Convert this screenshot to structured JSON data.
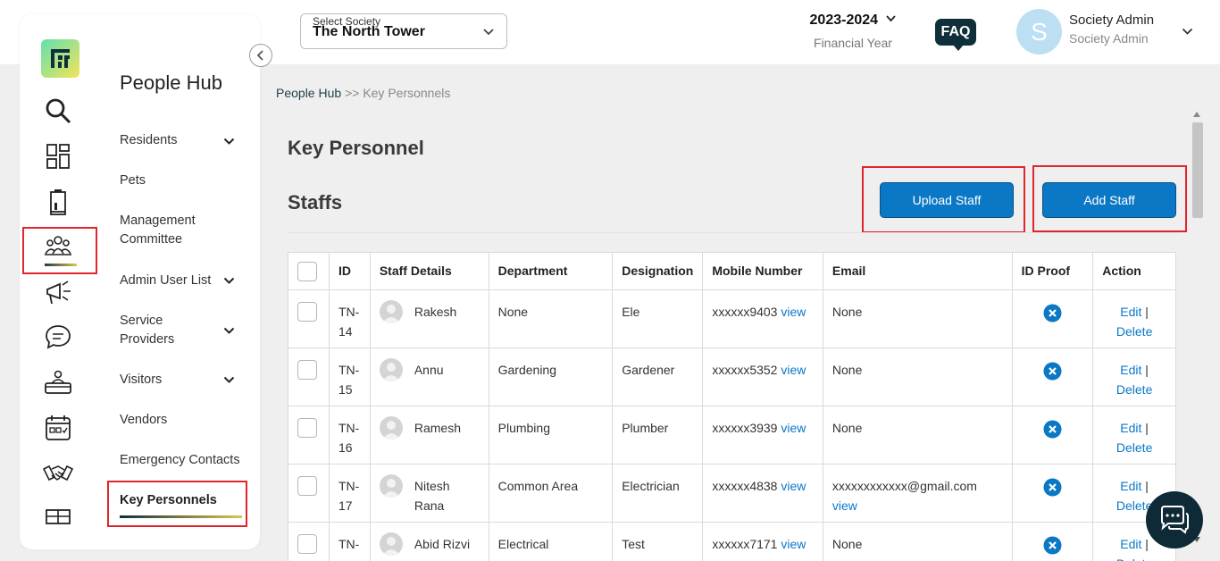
{
  "header": {
    "society_label": "Select Society",
    "society_value": "The North Tower",
    "financial_year": "2023-2024",
    "financial_year_label": "Financial Year",
    "faq_label": "FAQ",
    "avatar_initial": "S",
    "user_name": "Society Admin",
    "user_role": "Society Admin"
  },
  "sidebar": {
    "rail_icons": [
      "search-icon",
      "dashboard-icon",
      "building-icon",
      "people-icon",
      "announcement-icon",
      "chat-icon",
      "desk-service-icon",
      "calendar-icon",
      "handshake-icon",
      "package-icon"
    ],
    "hub_title": "People Hub",
    "items": [
      {
        "label": "Residents",
        "expandable": true
      },
      {
        "label": "Pets",
        "expandable": false
      },
      {
        "label": "Management Committee",
        "expandable": false
      },
      {
        "label": "Admin User List",
        "expandable": true
      },
      {
        "label": "Service Providers",
        "expandable": true
      },
      {
        "label": "Visitors",
        "expandable": true
      },
      {
        "label": "Vendors",
        "expandable": false
      },
      {
        "label": "Emergency Contacts",
        "expandable": false
      },
      {
        "label": "Key Personnels",
        "expandable": false,
        "active": true
      }
    ]
  },
  "breadcrumb": {
    "root": "People Hub",
    "separator": ">>",
    "current": "Key Personnels"
  },
  "main": {
    "page_title": "Key Personnel",
    "section_title": "Staffs",
    "upload_button": "Upload Staff",
    "add_button": "Add Staff"
  },
  "table": {
    "headers": [
      "ID",
      "Staff Details",
      "Department",
      "Designation",
      "Mobile Number",
      "Email",
      "ID Proof",
      "Action"
    ],
    "view_label": "view",
    "edit_label": "Edit",
    "delete_label": "Delete",
    "rows": [
      {
        "id": "TN-14",
        "name": "Rakesh",
        "department": "None",
        "designation": "Ele",
        "mobile": "xxxxxx9403",
        "email": "None",
        "email_view": false,
        "id_proof": "missing"
      },
      {
        "id": "TN-15",
        "name": "Annu",
        "department": "Gardening",
        "designation": "Gardener",
        "mobile": "xxxxxx5352",
        "email": "None",
        "email_view": false,
        "id_proof": "missing"
      },
      {
        "id": "TN-16",
        "name": "Ramesh",
        "department": "Plumbing",
        "designation": "Plumber",
        "mobile": "xxxxxx3939",
        "email": "None",
        "email_view": false,
        "id_proof": "missing"
      },
      {
        "id": "TN-17",
        "name": "Nitesh Rana",
        "department": "Common Area",
        "designation": "Electrician",
        "mobile": "xxxxxx4838",
        "email": "xxxxxxxxxxxx@gmail.com",
        "email_view": true,
        "id_proof": "missing"
      },
      {
        "id": "TN-",
        "name": "Abid Rizvi",
        "department": "Electrical",
        "designation": "Test",
        "mobile": "xxxxxx7171",
        "email": "None",
        "email_view": false,
        "id_proof": "missing"
      }
    ]
  },
  "colors": {
    "primary_button": "#0b78c6",
    "dark_brand": "#0f2f3a",
    "highlight_box": "#e0262b"
  }
}
